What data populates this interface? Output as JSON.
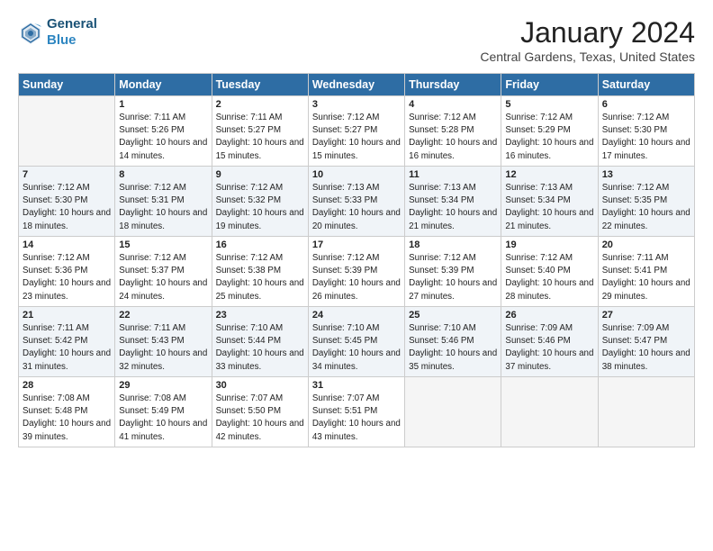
{
  "logo": {
    "line1": "General",
    "line2": "Blue"
  },
  "title": "January 2024",
  "subtitle": "Central Gardens, Texas, United States",
  "weekdays": [
    "Sunday",
    "Monday",
    "Tuesday",
    "Wednesday",
    "Thursday",
    "Friday",
    "Saturday"
  ],
  "weeks": [
    [
      {
        "day": "",
        "sunrise": "",
        "sunset": "",
        "daylight": "",
        "empty": true
      },
      {
        "day": "1",
        "sunrise": "Sunrise: 7:11 AM",
        "sunset": "Sunset: 5:26 PM",
        "daylight": "Daylight: 10 hours and 14 minutes."
      },
      {
        "day": "2",
        "sunrise": "Sunrise: 7:11 AM",
        "sunset": "Sunset: 5:27 PM",
        "daylight": "Daylight: 10 hours and 15 minutes."
      },
      {
        "day": "3",
        "sunrise": "Sunrise: 7:12 AM",
        "sunset": "Sunset: 5:27 PM",
        "daylight": "Daylight: 10 hours and 15 minutes."
      },
      {
        "day": "4",
        "sunrise": "Sunrise: 7:12 AM",
        "sunset": "Sunset: 5:28 PM",
        "daylight": "Daylight: 10 hours and 16 minutes."
      },
      {
        "day": "5",
        "sunrise": "Sunrise: 7:12 AM",
        "sunset": "Sunset: 5:29 PM",
        "daylight": "Daylight: 10 hours and 16 minutes."
      },
      {
        "day": "6",
        "sunrise": "Sunrise: 7:12 AM",
        "sunset": "Sunset: 5:30 PM",
        "daylight": "Daylight: 10 hours and 17 minutes."
      }
    ],
    [
      {
        "day": "7",
        "sunrise": "Sunrise: 7:12 AM",
        "sunset": "Sunset: 5:30 PM",
        "daylight": "Daylight: 10 hours and 18 minutes."
      },
      {
        "day": "8",
        "sunrise": "Sunrise: 7:12 AM",
        "sunset": "Sunset: 5:31 PM",
        "daylight": "Daylight: 10 hours and 18 minutes."
      },
      {
        "day": "9",
        "sunrise": "Sunrise: 7:12 AM",
        "sunset": "Sunset: 5:32 PM",
        "daylight": "Daylight: 10 hours and 19 minutes."
      },
      {
        "day": "10",
        "sunrise": "Sunrise: 7:13 AM",
        "sunset": "Sunset: 5:33 PM",
        "daylight": "Daylight: 10 hours and 20 minutes."
      },
      {
        "day": "11",
        "sunrise": "Sunrise: 7:13 AM",
        "sunset": "Sunset: 5:34 PM",
        "daylight": "Daylight: 10 hours and 21 minutes."
      },
      {
        "day": "12",
        "sunrise": "Sunrise: 7:13 AM",
        "sunset": "Sunset: 5:34 PM",
        "daylight": "Daylight: 10 hours and 21 minutes."
      },
      {
        "day": "13",
        "sunrise": "Sunrise: 7:12 AM",
        "sunset": "Sunset: 5:35 PM",
        "daylight": "Daylight: 10 hours and 22 minutes."
      }
    ],
    [
      {
        "day": "14",
        "sunrise": "Sunrise: 7:12 AM",
        "sunset": "Sunset: 5:36 PM",
        "daylight": "Daylight: 10 hours and 23 minutes."
      },
      {
        "day": "15",
        "sunrise": "Sunrise: 7:12 AM",
        "sunset": "Sunset: 5:37 PM",
        "daylight": "Daylight: 10 hours and 24 minutes."
      },
      {
        "day": "16",
        "sunrise": "Sunrise: 7:12 AM",
        "sunset": "Sunset: 5:38 PM",
        "daylight": "Daylight: 10 hours and 25 minutes."
      },
      {
        "day": "17",
        "sunrise": "Sunrise: 7:12 AM",
        "sunset": "Sunset: 5:39 PM",
        "daylight": "Daylight: 10 hours and 26 minutes."
      },
      {
        "day": "18",
        "sunrise": "Sunrise: 7:12 AM",
        "sunset": "Sunset: 5:39 PM",
        "daylight": "Daylight: 10 hours and 27 minutes."
      },
      {
        "day": "19",
        "sunrise": "Sunrise: 7:12 AM",
        "sunset": "Sunset: 5:40 PM",
        "daylight": "Daylight: 10 hours and 28 minutes."
      },
      {
        "day": "20",
        "sunrise": "Sunrise: 7:11 AM",
        "sunset": "Sunset: 5:41 PM",
        "daylight": "Daylight: 10 hours and 29 minutes."
      }
    ],
    [
      {
        "day": "21",
        "sunrise": "Sunrise: 7:11 AM",
        "sunset": "Sunset: 5:42 PM",
        "daylight": "Daylight: 10 hours and 31 minutes."
      },
      {
        "day": "22",
        "sunrise": "Sunrise: 7:11 AM",
        "sunset": "Sunset: 5:43 PM",
        "daylight": "Daylight: 10 hours and 32 minutes."
      },
      {
        "day": "23",
        "sunrise": "Sunrise: 7:10 AM",
        "sunset": "Sunset: 5:44 PM",
        "daylight": "Daylight: 10 hours and 33 minutes."
      },
      {
        "day": "24",
        "sunrise": "Sunrise: 7:10 AM",
        "sunset": "Sunset: 5:45 PM",
        "daylight": "Daylight: 10 hours and 34 minutes."
      },
      {
        "day": "25",
        "sunrise": "Sunrise: 7:10 AM",
        "sunset": "Sunset: 5:46 PM",
        "daylight": "Daylight: 10 hours and 35 minutes."
      },
      {
        "day": "26",
        "sunrise": "Sunrise: 7:09 AM",
        "sunset": "Sunset: 5:46 PM",
        "daylight": "Daylight: 10 hours and 37 minutes."
      },
      {
        "day": "27",
        "sunrise": "Sunrise: 7:09 AM",
        "sunset": "Sunset: 5:47 PM",
        "daylight": "Daylight: 10 hours and 38 minutes."
      }
    ],
    [
      {
        "day": "28",
        "sunrise": "Sunrise: 7:08 AM",
        "sunset": "Sunset: 5:48 PM",
        "daylight": "Daylight: 10 hours and 39 minutes."
      },
      {
        "day": "29",
        "sunrise": "Sunrise: 7:08 AM",
        "sunset": "Sunset: 5:49 PM",
        "daylight": "Daylight: 10 hours and 41 minutes."
      },
      {
        "day": "30",
        "sunrise": "Sunrise: 7:07 AM",
        "sunset": "Sunset: 5:50 PM",
        "daylight": "Daylight: 10 hours and 42 minutes."
      },
      {
        "day": "31",
        "sunrise": "Sunrise: 7:07 AM",
        "sunset": "Sunset: 5:51 PM",
        "daylight": "Daylight: 10 hours and 43 minutes."
      },
      {
        "day": "",
        "sunrise": "",
        "sunset": "",
        "daylight": "",
        "empty": true
      },
      {
        "day": "",
        "sunrise": "",
        "sunset": "",
        "daylight": "",
        "empty": true
      },
      {
        "day": "",
        "sunrise": "",
        "sunset": "",
        "daylight": "",
        "empty": true
      }
    ]
  ]
}
